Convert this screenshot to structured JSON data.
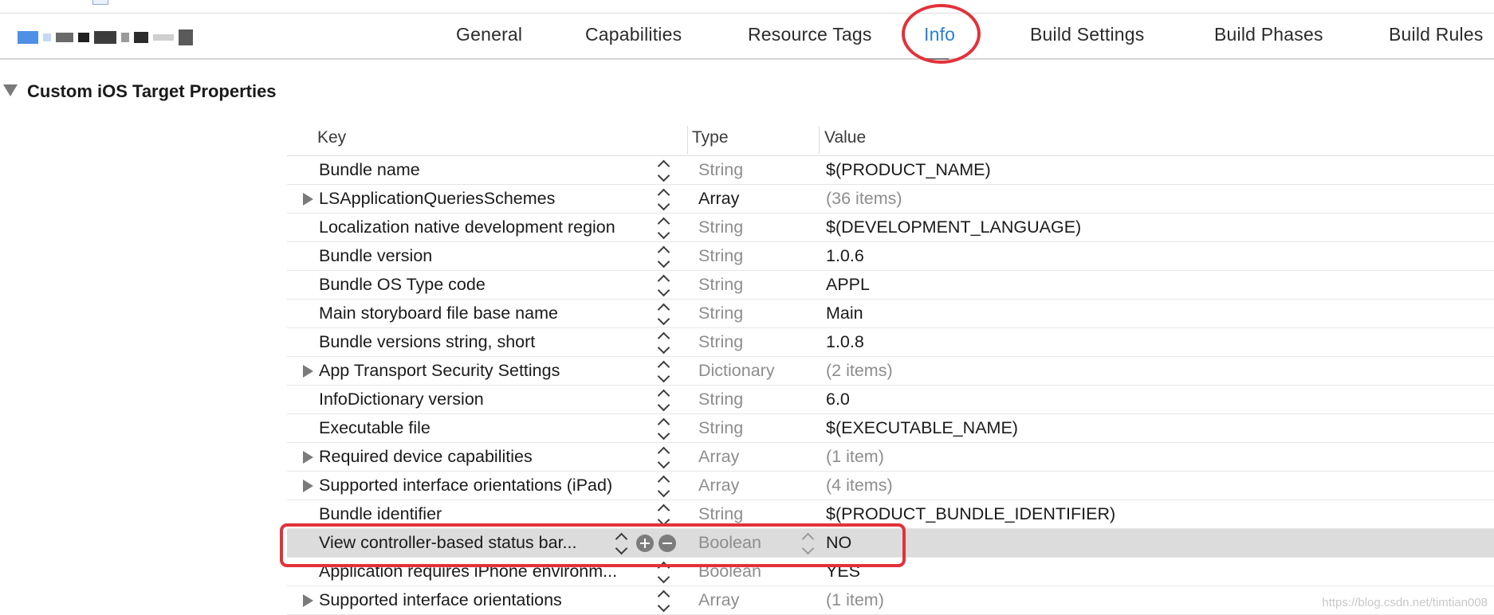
{
  "toolbar": {
    "project_name": "",
    "tabs": [
      {
        "label": "General",
        "active": false
      },
      {
        "label": "Capabilities",
        "active": false
      },
      {
        "label": "Resource Tags",
        "active": false
      },
      {
        "label": "Info",
        "active": true
      },
      {
        "label": "Build Settings",
        "active": false
      },
      {
        "label": "Build Phases",
        "active": false
      },
      {
        "label": "Build Rules",
        "active": false
      }
    ]
  },
  "section": {
    "title": "Custom iOS Target Properties",
    "expanded": true
  },
  "table": {
    "headers": {
      "key": "Key",
      "type": "Type",
      "value": "Value"
    },
    "rows": [
      {
        "key": "Bundle name",
        "type": "String",
        "value": "$(PRODUCT_NAME)",
        "expandable": false
      },
      {
        "key": "LSApplicationQueriesSchemes",
        "type": "Array",
        "value": "(36 items)",
        "expandable": true
      },
      {
        "key": "Localization native development region",
        "type": "String",
        "value": "$(DEVELOPMENT_LANGUAGE)",
        "expandable": false
      },
      {
        "key": "Bundle version",
        "type": "String",
        "value": "1.0.6",
        "expandable": false
      },
      {
        "key": "Bundle OS Type code",
        "type": "String",
        "value": "APPL",
        "expandable": false
      },
      {
        "key": "Main storyboard file base name",
        "type": "String",
        "value": "Main",
        "expandable": false
      },
      {
        "key": "Bundle versions string, short",
        "type": "String",
        "value": "1.0.8",
        "expandable": false
      },
      {
        "key": "App Transport Security Settings",
        "type": "Dictionary",
        "value": "(2 items)",
        "expandable": true
      },
      {
        "key": "InfoDictionary version",
        "type": "String",
        "value": "6.0",
        "expandable": false
      },
      {
        "key": "Executable file",
        "type": "String",
        "value": "$(EXECUTABLE_NAME)",
        "expandable": false
      },
      {
        "key": "Required device capabilities",
        "type": "Array",
        "value": "(1 item)",
        "expandable": true
      },
      {
        "key": "Supported interface orientations (iPad)",
        "type": "Array",
        "value": "(4 items)",
        "expandable": true
      },
      {
        "key": "Bundle identifier",
        "type": "String",
        "value": "$(PRODUCT_BUNDLE_IDENTIFIER)",
        "expandable": false
      },
      {
        "key": "View controller-based status bar...",
        "type": "Boolean",
        "value": "NO",
        "expandable": false,
        "selected": true
      },
      {
        "key": "Application requires iPhone environm...",
        "type": "Boolean",
        "value": "YES",
        "expandable": false
      },
      {
        "key": "Supported interface orientations",
        "type": "Array",
        "value": "(1 item)",
        "expandable": true
      }
    ]
  },
  "watermark": "https://blog.csdn.net/timtian008",
  "colors": {
    "accent": "#2a7fd4",
    "annotation": "#e2323a",
    "selected_row": "#dcdcdc",
    "muted_text": "#8d8d8d"
  },
  "icons": [
    "disclosure-triangle-icon",
    "stepper-icon",
    "plus-circle-icon",
    "minus-circle-icon"
  ]
}
